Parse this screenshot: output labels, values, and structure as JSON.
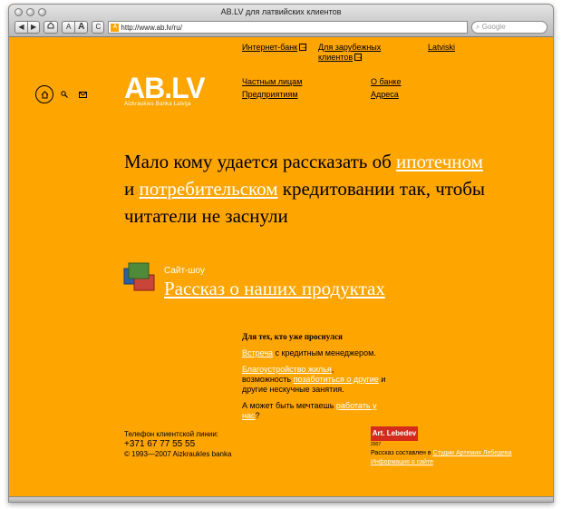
{
  "window": {
    "title": "AB.LV для латвийских клиентов",
    "url": "http://www.ab.lv/ru/",
    "search_placeholder": "Google",
    "back_glyph": "◀",
    "forward_glyph": "▶",
    "font_small": "A",
    "font_large": "A",
    "reload_glyph": "C",
    "favicon_letter": "A"
  },
  "top_links": {
    "internet_bank": "Интернет-банк",
    "foreign_clients_line1": "Для зарубежных",
    "foreign_clients_line2": "клиентов",
    "latviski": "Latviski"
  },
  "main_nav": {
    "private": "Частным лицам",
    "business": "Предприятиям",
    "about": "О банке",
    "addresses": "Адреса"
  },
  "logo": {
    "main": "AB.LV",
    "sub": "Aizkraukles Banka Latvija"
  },
  "headline": {
    "part1": "Мало кому удается рассказать об ",
    "link1": "ипотечном",
    "part2": "и ",
    "link2": "потребительском",
    "part3": " кредитовании так, чтобы читатели не заснули"
  },
  "slideshow": {
    "label": "Сайт-шоу",
    "link": "Рассказ о наших продуктах"
  },
  "wake": {
    "title": "Для тех, кто уже проснулся",
    "meeting_link": "Встреча",
    "meeting_text": " с кредитным менеджером.",
    "home_link": "Благоустройство жилья",
    "home_text1": ",",
    "home_text2": "возможность ",
    "care_link": "позаботиться о другие",
    "home_text3": " и другие нескучные занятия.",
    "dream_text": "А может быть мечтаешь ",
    "work_link": "работать у нас",
    "dream_end": "?"
  },
  "footer": {
    "phone_label": "Телефон клиентской линии:",
    "phone": "+371 67 77 55 55",
    "copyright": "© 1993—2007 Aizkraukles banka",
    "studio_logo": "Art. Lebedev",
    "studio_year": "2007",
    "credits_text": "Рассказ составлен в ",
    "credits_link": "Студии Артемия Лебедева",
    "about_site": "Информация о сайте"
  },
  "colors": {
    "page_bg": "#ffa500",
    "link_white": "#ffffff",
    "studio_red": "#d32b1e"
  }
}
